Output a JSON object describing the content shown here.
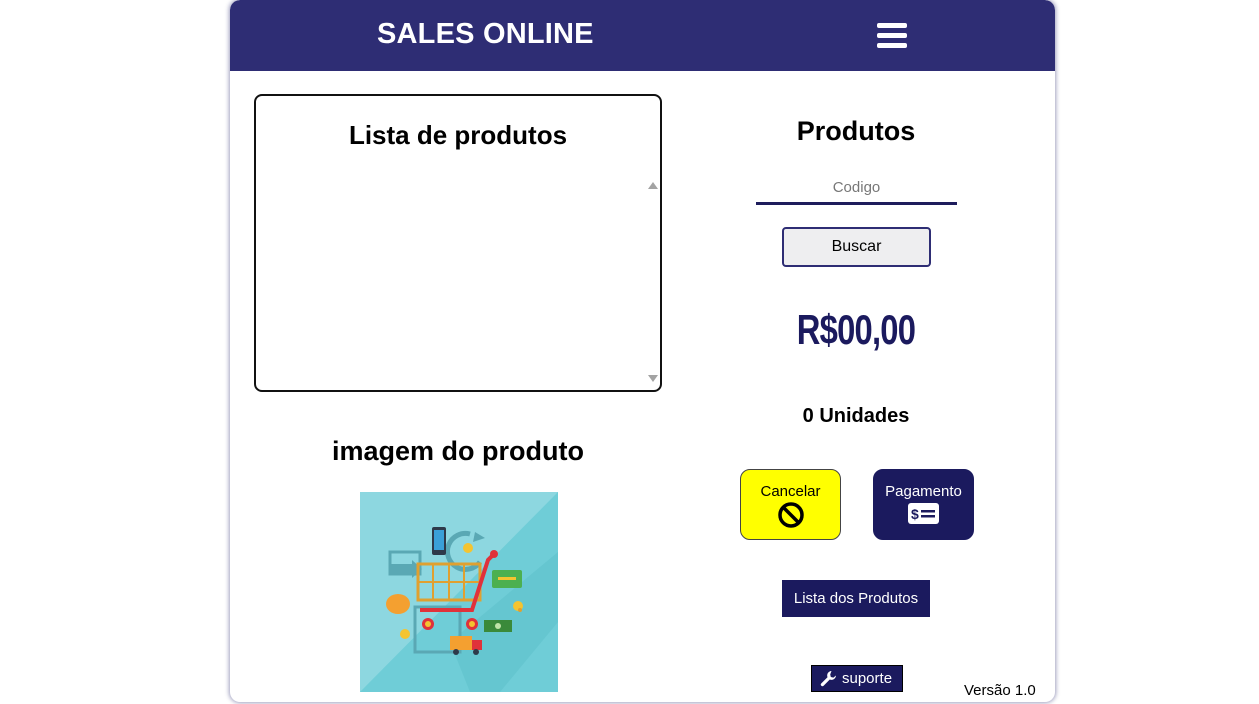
{
  "header": {
    "title": "SALES ONLINE",
    "menu_icon": "hamburger-menu-icon"
  },
  "product_list": {
    "title": "Lista de produtos",
    "items": []
  },
  "product_image": {
    "title": "imagem do produto",
    "alt_icon": "shopping-cart-illustration"
  },
  "products_panel": {
    "title": "Produtos",
    "code_placeholder": "Codigo",
    "search_label": "Buscar",
    "price": "R$00,00",
    "units": "0 Unidades"
  },
  "actions": {
    "cancel_label": "Cancelar",
    "cancel_icon": "prohibited-icon",
    "payment_label": "Pagamento",
    "payment_icon": "money-bill-icon",
    "list_products_label": "Lista dos Produtos",
    "support_label": "suporte",
    "support_icon": "wrench-icon"
  },
  "footer": {
    "version": "Versão 1.0"
  },
  "colors": {
    "primary": "#2e2d74",
    "dark_navy": "#1b1a5e",
    "cancel_yellow": "#ffff00",
    "image_bg": "#8dd7e0"
  }
}
